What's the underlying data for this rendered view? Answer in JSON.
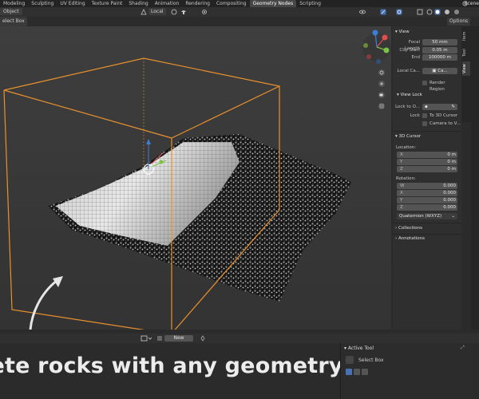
{
  "workspace_tabs": [
    {
      "label": "Modeling",
      "active": false
    },
    {
      "label": "Sculpting",
      "active": false
    },
    {
      "label": "UV Editing",
      "active": false
    },
    {
      "label": "Texture Paint",
      "active": false
    },
    {
      "label": "Shading",
      "active": false
    },
    {
      "label": "Animation",
      "active": false
    },
    {
      "label": "Rendering",
      "active": false
    },
    {
      "label": "Compositing",
      "active": false
    },
    {
      "label": "Geometry Nodes",
      "active": true
    },
    {
      "label": "Scripting",
      "active": false
    }
  ],
  "scene_label": "Scene",
  "header": {
    "mode": "Object",
    "orientation": "Local"
  },
  "toolbar": {
    "select_label": "elect Box"
  },
  "options_label": "Options",
  "view_panel": {
    "title": "View",
    "focal_length_label": "Focal Length",
    "focal_length": "50 mm",
    "clip_start_label": "Clip Start",
    "clip_start": "0.05 m",
    "end_label": "End",
    "end": "100000 m",
    "local_camera_label": "Local Ca...",
    "local_camera_value": "Ca...",
    "render_region_label": "Render Region"
  },
  "view_lock": {
    "title": "View Lock",
    "lock_to_label": "Lock to O...",
    "lock_label": "Lock",
    "to_3d_cursor": "To 3D Cursor",
    "camera_to_view": "Camera to V..."
  },
  "cursor_panel": {
    "title": "3D Cursor",
    "location_label": "Location:",
    "location": [
      {
        "axis": "X",
        "value": "0 m"
      },
      {
        "axis": "Y",
        "value": "0 m"
      },
      {
        "axis": "Z",
        "value": "0 m"
      }
    ],
    "rotation_label": "Rotation:",
    "rotation": [
      {
        "axis": "W",
        "value": "0.000"
      },
      {
        "axis": "X",
        "value": "0.000"
      },
      {
        "axis": "Y",
        "value": "0.000"
      },
      {
        "axis": "Z",
        "value": "0.000"
      }
    ],
    "rotation_mode": "Quaternion (WXYZ)"
  },
  "collapsed_panels": [
    "Collections",
    "Annotations"
  ],
  "n_tabs": [
    "Item",
    "Tool",
    "View"
  ],
  "footer": {
    "new_label": "New"
  },
  "caption": "lete rocks with any geometry",
  "active_tool": {
    "title": "Active Tool",
    "name": "Select Box"
  },
  "colors": {
    "accent_orange": "#e8912d",
    "panel_bg": "#2f2f2f",
    "viewport_bg": "#3a3a3a",
    "field_bg": "#545454",
    "active_tab": "#464646"
  }
}
